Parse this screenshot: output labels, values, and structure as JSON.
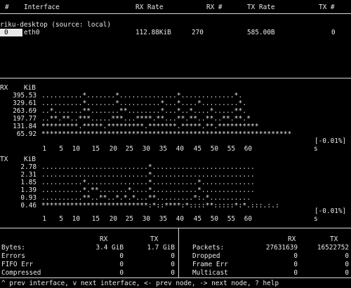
{
  "header": {
    "hash": "#",
    "interface": "Interface",
    "rx_rate": "RX Rate",
    "rx_count": "RX #",
    "tx_rate": "TX Rate",
    "tx_count": "TX #"
  },
  "node": {
    "title": "riku-desktop (source: local)",
    "row": {
      "index": "0",
      "name": "eth0",
      "rx_rate": "112.88KiB",
      "rx_count": "270",
      "tx_rate": "585.00B",
      "tx_count": "0"
    }
  },
  "rx_graph": {
    "label": "RX",
    "unit": "KiB",
    "rows": [
      {
        "value": "395.53",
        "dots": "..........*.......*..............*.............*."
      },
      {
        "value": "329.61",
        "dots": "..........*.......*..........*...*....*.........*."
      },
      {
        "value": "263.69",
        "dots": "..*.......**.......**........*...*..*....*.....**."
      },
      {
        "value": "197.77",
        "dots": "..**.**..***.....***...****.**...**.**..**..**.**.*"
      },
      {
        "value": "131.84",
        "dots": "*********.*****.*********.*******.*****.**.**********"
      },
      {
        "value": "65.92",
        "dots": "*************************************************************"
      }
    ],
    "pct": "[-0.01%]",
    "axis": [
      "1",
      "5",
      "10",
      "15",
      "20",
      "25",
      "30",
      "35",
      "40",
      "45",
      "50",
      "55",
      "60"
    ],
    "axis_unit": "s"
  },
  "tx_graph": {
    "label": "TX",
    "unit": "KiB",
    "rows": [
      {
        "value": "2.78",
        "dots": "..........................*........................."
      },
      {
        "value": "2.31",
        "dots": "..........................*........................."
      },
      {
        "value": "1.85",
        "dots": "..........*...............*...........*............."
      },
      {
        "value": "1.39",
        "dots": "..........*.**.......*....*...........*............."
      },
      {
        "value": "0.93",
        "dots": "..........**..**..*.*.*...**.........*:.*.........."
      },
      {
        "value": "0.46",
        "dots": "**************************:*::****:*::::**:::::*:*.:::.:.:"
      }
    ],
    "pct": "[-0.01%]",
    "axis": [
      "1",
      "5",
      "10",
      "15",
      "20",
      "25",
      "30",
      "35",
      "40",
      "45",
      "50",
      "55",
      "60"
    ],
    "axis_unit": "s"
  },
  "stats_left": {
    "col_rx": "RX",
    "col_tx": "TX",
    "rows": [
      {
        "label": "Bytes:",
        "rx": "3.4 GiB",
        "tx": "1.7 GiB"
      },
      {
        "label": "Errors",
        "rx": "0",
        "tx": "0"
      },
      {
        "label": "FIFO Err",
        "rx": "0",
        "tx": "0"
      },
      {
        "label": "Compressed",
        "rx": "0",
        "tx": "0"
      }
    ]
  },
  "stats_right": {
    "col_rx": "RX",
    "col_tx": "TX",
    "rows": [
      {
        "label": "Packets:",
        "rx": "27631639",
        "tx": "16522752"
      },
      {
        "label": "Dropped",
        "rx": "0",
        "tx": "0"
      },
      {
        "label": "Frame Err",
        "rx": "0",
        "tx": "0"
      },
      {
        "label": "Multicast",
        "rx": "0",
        "tx": "0"
      }
    ]
  },
  "help_bar": "^ prev interface, v next interface, <- prev node, -> next node, ? help"
}
